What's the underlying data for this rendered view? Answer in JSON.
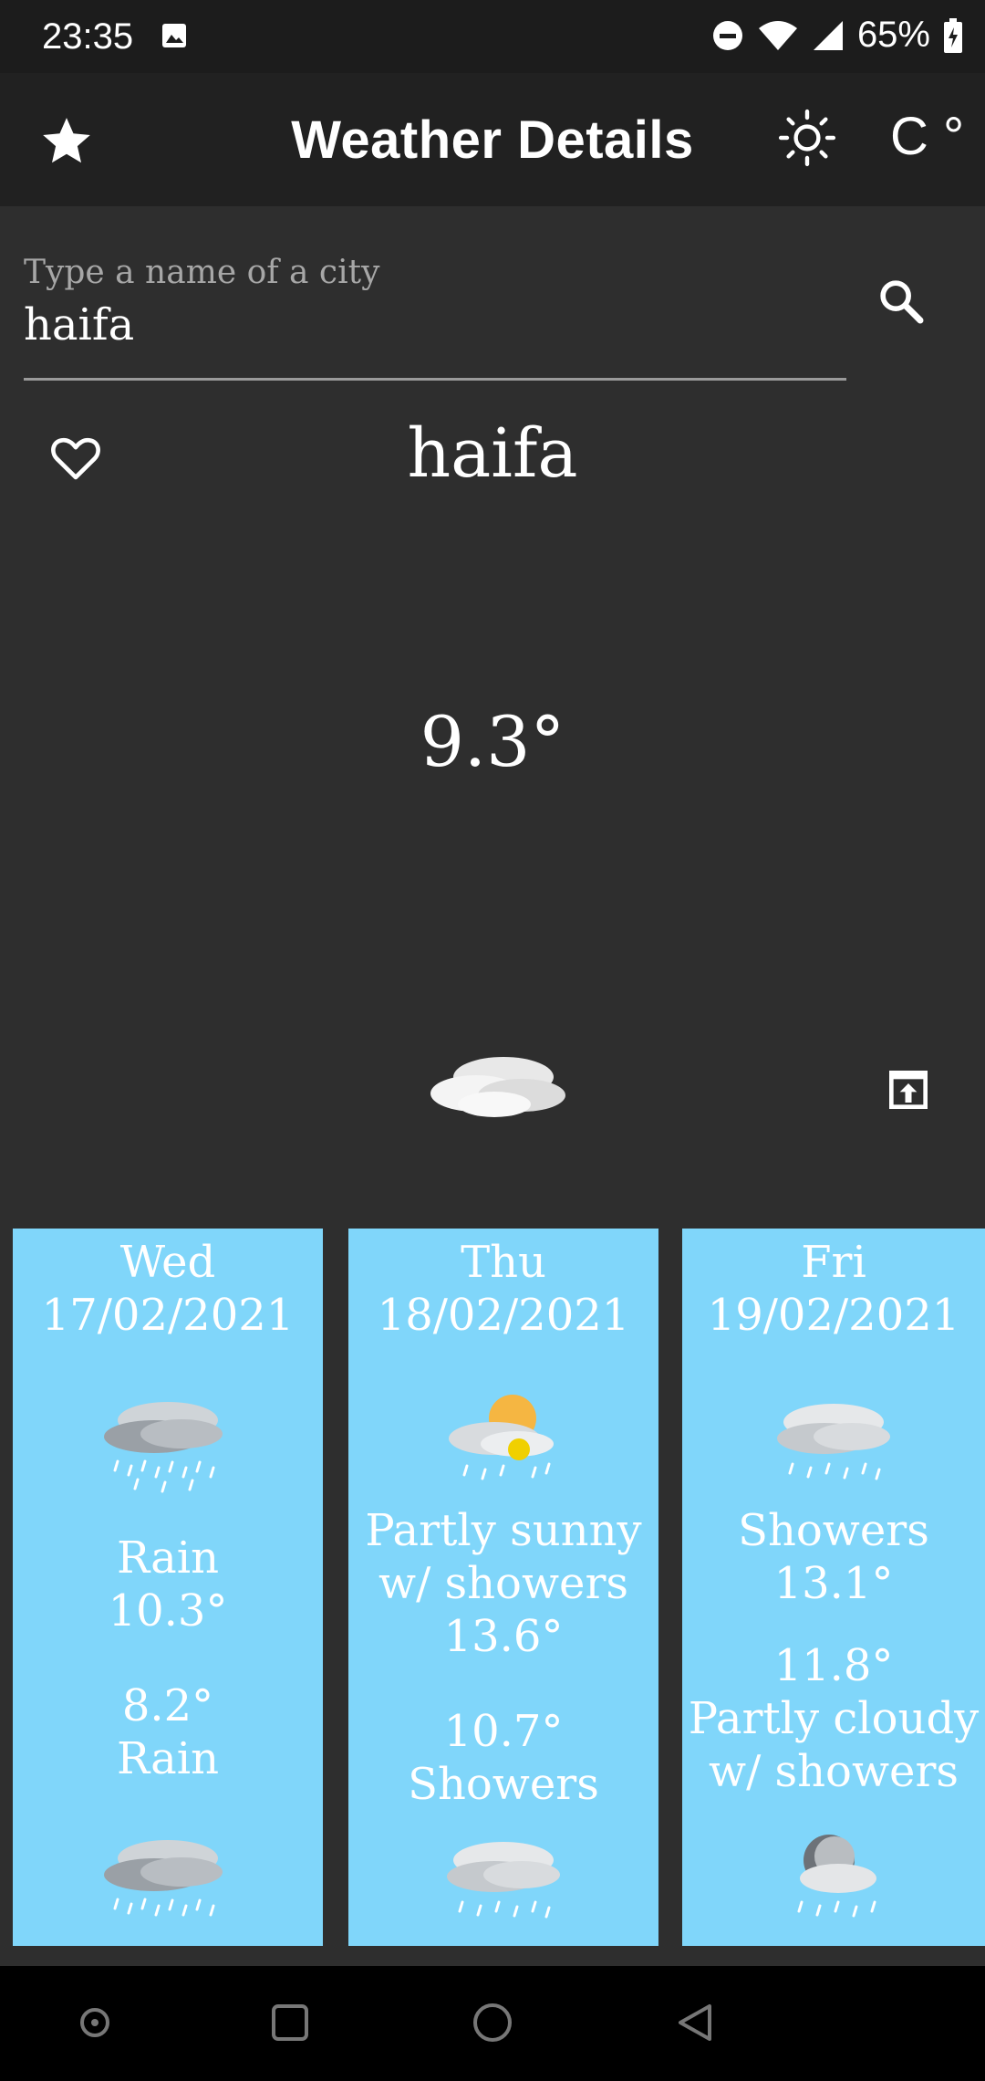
{
  "status_bar": {
    "time": "23:35",
    "battery_percent": "65%"
  },
  "app_bar": {
    "title": "Weather Details",
    "unit_label": "C °"
  },
  "search": {
    "hint": "Type a name of a city",
    "value": "haifa"
  },
  "current": {
    "city": "haifa",
    "temperature": "9.3°"
  },
  "forecast": [
    {
      "day": "Wed",
      "date": "17/02/2021",
      "day_condition": "Rain",
      "day_temp": "10.3°",
      "night_temp": "8.2°",
      "night_condition": "Rain"
    },
    {
      "day": "Thu",
      "date": "18/02/2021",
      "day_condition_line1": "Partly sunny",
      "day_condition_line2": "w/ showers",
      "day_temp": "13.6°",
      "night_temp": "10.7°",
      "night_condition": "Showers"
    },
    {
      "day": "Fri",
      "date": "19/02/2021",
      "day_condition": "Showers",
      "day_temp": "13.1°",
      "night_temp": "11.8°",
      "night_condition_line1": "Partly cloudy",
      "night_condition_line2": "w/ showers"
    }
  ],
  "colors": {
    "background": "#2e2e2e",
    "app_bar": "#212121",
    "card": "#80d6fa"
  }
}
